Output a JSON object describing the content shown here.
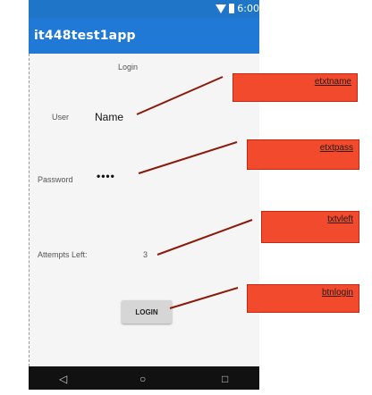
{
  "status_bar": {
    "time": "6:00"
  },
  "app_bar": {
    "title": "it448test1app"
  },
  "form": {
    "title": "Login",
    "user_label": "User",
    "user_value": "Name",
    "password_label": "Password",
    "password_value": "••••",
    "attempts_label": "Attempts Left:",
    "attempts_value": "3",
    "login_button": "LOGIN"
  },
  "annotations": {
    "etxtname": "etxtname",
    "etxtpass": "etxtpass",
    "txtvleft": "txtvleft",
    "btnlogin": "btnlogin"
  },
  "nav": {
    "back_icon": "◁",
    "home_icon": "○",
    "recents_icon": "□"
  },
  "colors": {
    "app_bar": "#2179d6",
    "annotation": "#f14a2d",
    "connector": "#8b1a0a"
  }
}
